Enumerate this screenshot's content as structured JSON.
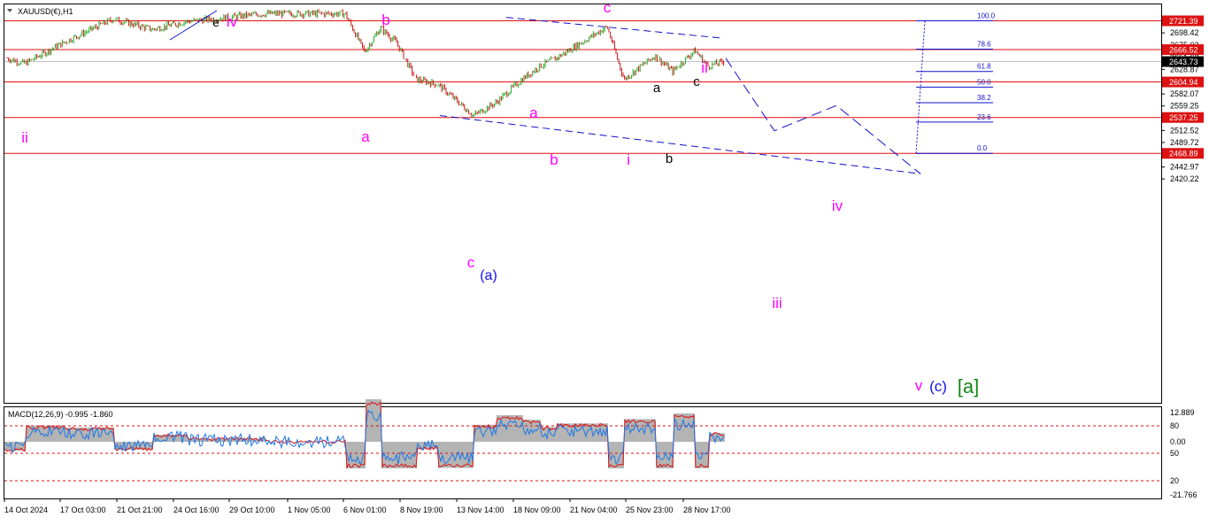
{
  "symbol_label": "XAUUSD(€),H1",
  "colors": {
    "bull_candle": "#22aa22",
    "bear_candle": "#cc1111",
    "level_line": "#dd1111",
    "price_tag_bg": "#dd1111",
    "current_price_bg": "#000000",
    "wave_pink": "#ff00ff",
    "wave_blue": "#1010ee",
    "wave_green": "#118811",
    "projection": "#1010cc",
    "fib": "#1010cc",
    "macd_hist": "#b4b4b4",
    "macd_signal": "#dd1111",
    "macd_main": "#1e78e6"
  },
  "price_axis": {
    "ticks": [
      "2698.42",
      "2675.02",
      "2651.62",
      "2628.87",
      "2582.07",
      "2559.25",
      "2535.84",
      "2512.52",
      "2489.72",
      "2466.27",
      "2442.97",
      "2420.22"
    ]
  },
  "levels": [
    {
      "price": "2721.39"
    },
    {
      "price": "2666.52"
    },
    {
      "price": "2604.94"
    },
    {
      "price": "2537.25"
    },
    {
      "price": "2468.89"
    }
  ],
  "current_price": "2643.73",
  "fib_levels": [
    "100.0",
    "78.6",
    "61.8",
    "50.0",
    "38.2",
    "23.6",
    "0.0"
  ],
  "wave_labels": [
    {
      "text": "ii",
      "color": "pink"
    },
    {
      "text": "e",
      "color": "black"
    },
    {
      "text": "iv",
      "color": "pink"
    },
    {
      "text": "b",
      "color": "pink"
    },
    {
      "text": "a",
      "color": "pink"
    },
    {
      "text": "c",
      "color": "pink"
    },
    {
      "text": "(a)",
      "color": "blue"
    },
    {
      "text": "a",
      "color": "pink"
    },
    {
      "text": "b",
      "color": "pink"
    },
    {
      "text": "c",
      "color": "pink"
    },
    {
      "text": "i",
      "color": "pink"
    },
    {
      "text": "a",
      "color": "black"
    },
    {
      "text": "b",
      "color": "black"
    },
    {
      "text": "c",
      "color": "black"
    },
    {
      "text": "ii",
      "color": "pink"
    },
    {
      "text": "iii",
      "color": "pink"
    },
    {
      "text": "iv",
      "color": "pink"
    },
    {
      "text": "v",
      "color": "pink"
    },
    {
      "text": "(c)",
      "color": "blue"
    },
    {
      "text": "[a]",
      "color": "green"
    }
  ],
  "time_axis": [
    "14 Oct 2024",
    "17 Oct 03:00",
    "21 Oct 21:00",
    "24 Oct 16:00",
    "29 Oct 10:00",
    "1 Nov 05:00",
    "6 Nov 01:00",
    "8 Nov 19:00",
    "13 Nov 14:00",
    "18 Nov 09:00",
    "21 Nov 04:00",
    "25 Nov 23:00",
    "28 Nov 17:00"
  ],
  "macd": {
    "label": "MACD(12,26,9) -0.995 -1.860",
    "ticks": [
      "12.889",
      "80",
      "0.00",
      "50",
      "20",
      "-21.766"
    ]
  },
  "chart_data": {
    "type": "candlestick",
    "title": "XAUUSD(€),H1",
    "timeframe": "H1",
    "x_range": [
      "14 Oct 2024",
      "2 Dec 2024"
    ],
    "ylim": [
      2418,
      2730
    ],
    "price_path": [
      {
        "t": "14 Oct 2024",
        "p": 2650
      },
      {
        "t": "15 Oct 2024",
        "p": 2640
      },
      {
        "t": "17 Oct 2024",
        "p": 2680
      },
      {
        "t": "21 Oct 2024",
        "p": 2725
      },
      {
        "t": "23 Oct 2024",
        "p": 2705
      },
      {
        "t": "24 Oct 2024",
        "p": 2720
      },
      {
        "t": "29 Oct 2024",
        "p": 2735
      },
      {
        "t": "1 Nov 2024",
        "p": 2735
      },
      {
        "t": "5 Nov 2024",
        "p": 2735
      },
      {
        "t": "6 Nov 2024",
        "p": 2662
      },
      {
        "t": "7 Nov 2024",
        "p": 2708
      },
      {
        "t": "8 Nov 2024",
        "p": 2680
      },
      {
        "t": "11 Nov 2024",
        "p": 2610
      },
      {
        "t": "12 Nov 2024",
        "p": 2600
      },
      {
        "t": "14 Nov 2024",
        "p": 2541
      },
      {
        "t": "15 Nov 2024",
        "p": 2565
      },
      {
        "t": "18 Nov 2024",
        "p": 2610
      },
      {
        "t": "19 Nov 2024",
        "p": 2635
      },
      {
        "t": "20 Nov 2024",
        "p": 2650
      },
      {
        "t": "22 Nov 2024",
        "p": 2710
      },
      {
        "t": "25 Nov 2024",
        "p": 2610
      },
      {
        "t": "26 Nov 2024",
        "p": 2655
      },
      {
        "t": "27 Nov 2024",
        "p": 2625
      },
      {
        "t": "28 Nov 2024",
        "p": 2665
      },
      {
        "t": "29 Nov 2024",
        "p": 2635
      },
      {
        "t": "2 Dec 2024",
        "p": 2643.73
      }
    ],
    "projection_path": [
      {
        "label": "ii",
        "p": 2650
      },
      {
        "label": "iii",
        "p": 2512
      },
      {
        "label": "iv",
        "p": 2560
      },
      {
        "label": "v",
        "p": 2430
      }
    ],
    "fibonacci": {
      "high": 2721.39,
      "low": 2468.89,
      "ratios": [
        100.0,
        78.6,
        61.8,
        50.0,
        38.2,
        23.6,
        0.0
      ]
    },
    "horizontal_levels": [
      2721.39,
      2666.52,
      2604.94,
      2537.25,
      2468.89
    ],
    "trendlines": [
      {
        "from": {
          "t": "14 Nov 2024",
          "p": 2541
        },
        "to": {
          "t": "4 Dec 2024",
          "p": 2430
        }
      },
      {
        "from": {
          "t": "19 Nov 2024",
          "p": 2728
        },
        "to": {
          "t": "29 Nov 2024",
          "p": 2688
        }
      }
    ],
    "indicator": {
      "name": "MACD(12,26,9)",
      "main": -0.995,
      "signal": -1.86,
      "levels": [
        80,
        50,
        20
      ]
    }
  }
}
